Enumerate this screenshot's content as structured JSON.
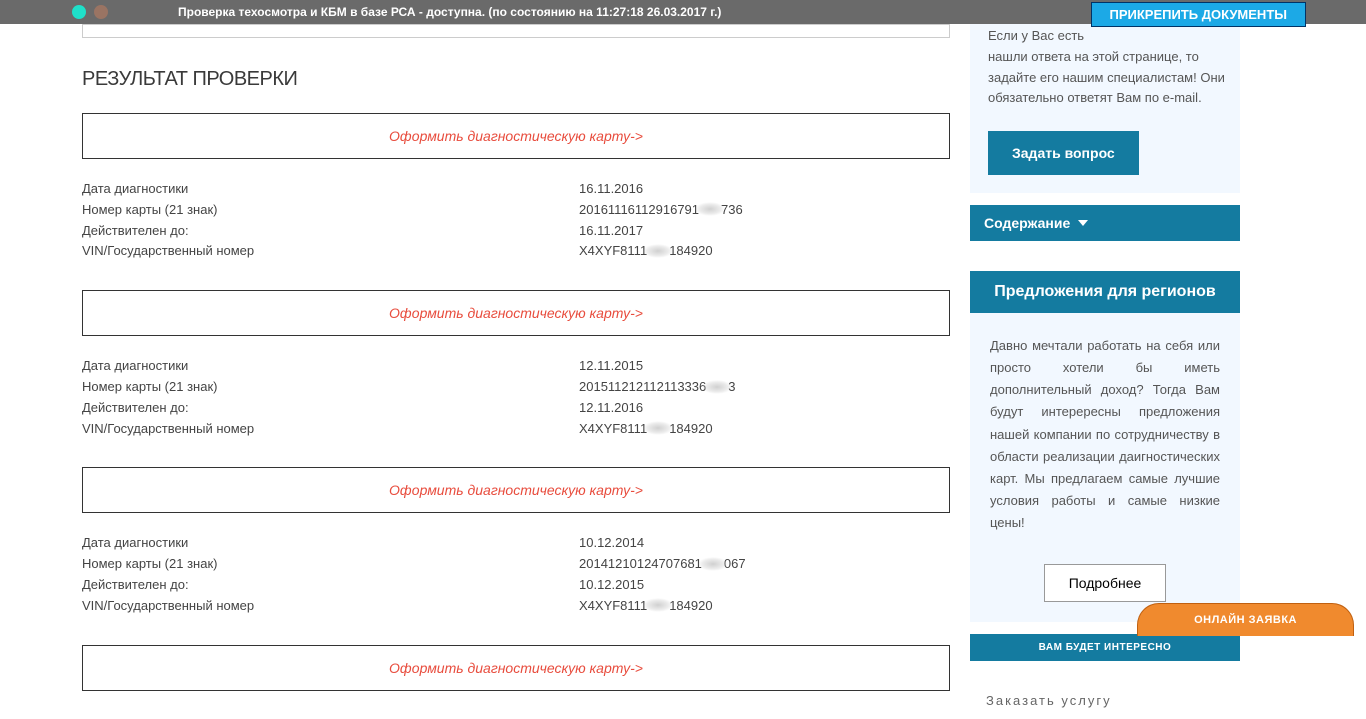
{
  "topbar": {
    "status_text": "Проверка техосмотра и КБМ в базе РСА - доступна. (по состоянию на 11:27:18 26.03.2017 г.)"
  },
  "attach_button": "ПРИКРЕПИТЬ ДОКУМЕНТЫ",
  "main": {
    "heading": "РЕЗУЛЬТАТ ПРОВЕРКИ",
    "diag_link_text": "Оформить диагностическую карту->",
    "labels": {
      "date": "Дата диагностики",
      "card": "Номер карты (21 знак)",
      "valid": "Действителен до:",
      "vin": "VIN/Государственный номер"
    },
    "records": [
      {
        "date": "16.11.2016",
        "card_pre": "20161116112916791",
        "card_post": "736",
        "valid": "16.11.2017",
        "vin_pre": "X4XYF8111",
        "vin_post": "184920"
      },
      {
        "date": "12.11.2015",
        "card_pre": "201511212112113336",
        "card_post": "3",
        "valid": "12.11.2016",
        "vin_pre": "X4XYF8111",
        "vin_post": "184920"
      },
      {
        "date": "10.12.2014",
        "card_pre": "20141210124707681",
        "card_post": "067",
        "valid": "10.12.2015",
        "vin_pre": "X4XYF8111",
        "vin_post": "184920"
      }
    ]
  },
  "sidebar": {
    "help_text_top": "Если у Вас есть",
    "help_text": "нашли ответа на этой странице, то задайте его нашим специалистам! Они обязательно ответят Вам по e-mail.",
    "ask_button": "Задать вопрос",
    "contents_label": "Содержание",
    "offers_header": "Предложения для регионов",
    "offers_text": "Давно мечтали работать на себя или просто хотели бы иметь дополнительный доход? Тогда Вам будут интерересны предложения нашей компании по сотрудничеству в области реализации даигностических карт. Мы предлагаем самые лучшие условия работы и самые низкие цены!",
    "more_button": "Подробнее",
    "interest_label": "ВАМ БУДЕТ ИНТЕРЕСНО",
    "order_text": "Заказать услугу"
  },
  "online_button": "ОНЛАЙН ЗАЯВКА"
}
